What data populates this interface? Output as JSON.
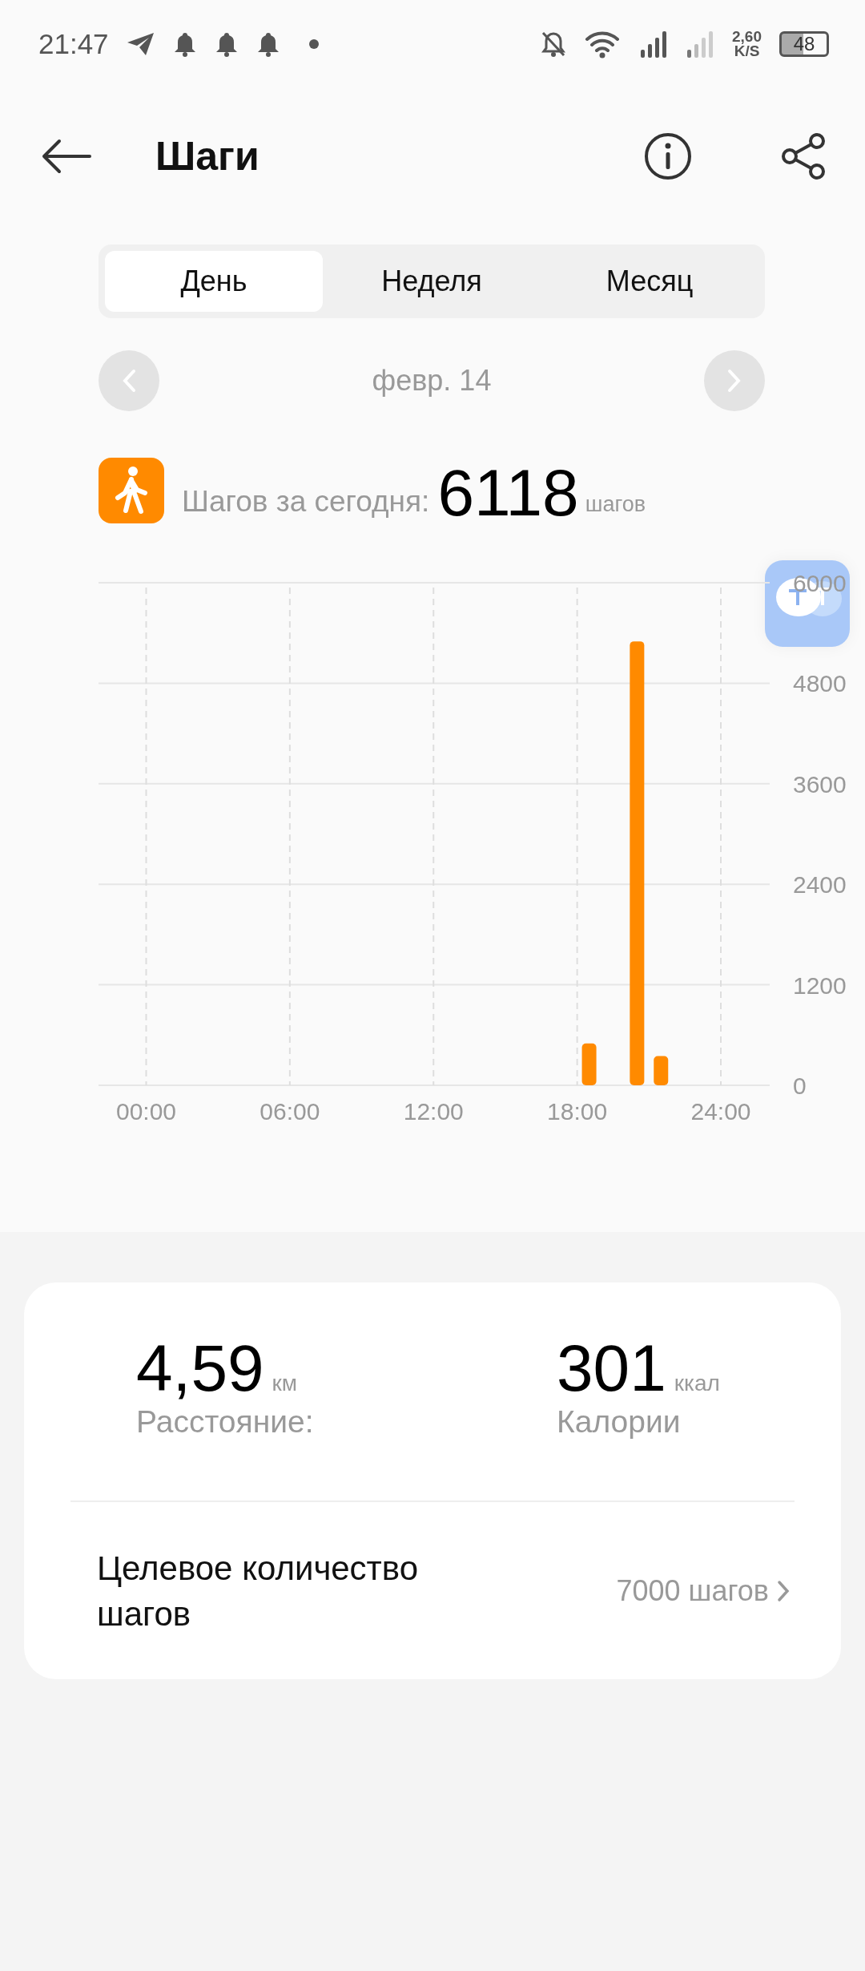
{
  "status_bar": {
    "time": "21:47",
    "speed": "2,60",
    "speed_unit": "K/S",
    "battery": "48"
  },
  "header": {
    "title": "Шаги"
  },
  "tabs": [
    {
      "label": "День",
      "selected": true
    },
    {
      "label": "Неделя",
      "selected": false
    },
    {
      "label": "Месяц",
      "selected": false
    }
  ],
  "date": "февр. 14",
  "summary": {
    "label": "Шагов за сегодня:",
    "value": "6118",
    "unit": "шагов"
  },
  "chart_data": {
    "type": "bar",
    "x": [
      18.5,
      20.5,
      21.5
    ],
    "values": [
      500,
      5300,
      350
    ],
    "grid": true,
    "xlim": [
      0,
      24
    ],
    "xticks": [
      {
        "value": 0,
        "label": "00:00"
      },
      {
        "value": 6,
        "label": "06:00"
      },
      {
        "value": 12,
        "label": "12:00"
      },
      {
        "value": 18,
        "label": "18:00"
      },
      {
        "value": 24,
        "label": "24:00"
      }
    ],
    "ylim": [
      0,
      6000
    ],
    "yticks": [
      0,
      1200,
      2400,
      3600,
      4800,
      6000
    ]
  },
  "stats": [
    {
      "value": "4,59",
      "unit": "км",
      "label": "Расстояние:"
    },
    {
      "value": "301",
      "unit": "ккал",
      "label": "Калории"
    }
  ],
  "goal": {
    "label": "Целевое количество шагов",
    "value": "7000 шагов"
  }
}
